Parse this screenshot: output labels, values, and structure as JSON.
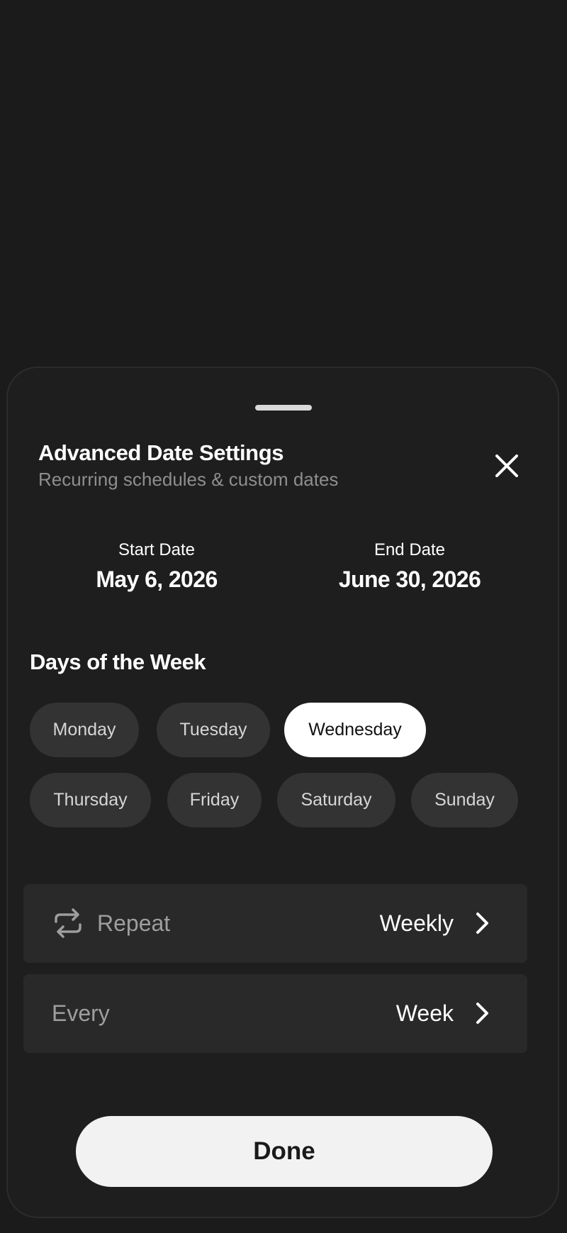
{
  "sheet": {
    "title": "Advanced Date Settings",
    "subtitle": "Recurring schedules & custom dates",
    "close_icon": "close-icon"
  },
  "dates": {
    "start_label": "Start Date",
    "start_value": "May 6, 2026",
    "end_label": "End Date",
    "end_value": "June 30, 2026"
  },
  "days": {
    "title": "Days of the Week",
    "items": [
      {
        "label": "Monday",
        "selected": false
      },
      {
        "label": "Tuesday",
        "selected": false
      },
      {
        "label": "Wednesday",
        "selected": true
      },
      {
        "label": "Thursday",
        "selected": false
      },
      {
        "label": "Friday",
        "selected": false
      },
      {
        "label": "Saturday",
        "selected": false
      },
      {
        "label": "Sunday",
        "selected": false
      }
    ]
  },
  "repeat": {
    "icon": "repeat-icon",
    "label": "Repeat",
    "value": "Weekly"
  },
  "every": {
    "label": "Every",
    "value": "Week"
  },
  "done_label": "Done",
  "colors": {
    "background": "#1b1b1b",
    "sheet": "#1e1e1e",
    "chip": "#333333",
    "chip_selected": "#ffffff",
    "row": "#292929",
    "button": "#f2f2f2"
  }
}
